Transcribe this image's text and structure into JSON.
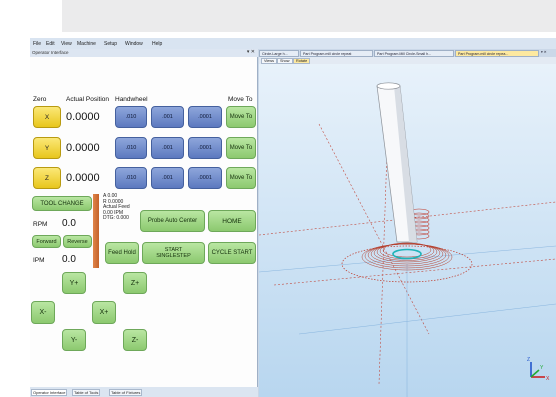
{
  "menu": [
    "File",
    "Edit",
    "View",
    "Machine",
    "Setup",
    "Window",
    "Help"
  ],
  "panel_title": "Operator Interface",
  "panel_pin": "▾ ✕",
  "headers": {
    "zero": "Zero",
    "actual_position": "Actual Position",
    "handwheel": "Handwheel",
    "move_to": "Move To"
  },
  "axes": [
    {
      "label": "X",
      "value": "0.0000",
      "steps": [
        ".010",
        ".001",
        ".0001"
      ],
      "move": "Move To"
    },
    {
      "label": "Y",
      "value": "0.0000",
      "steps": [
        ".010",
        ".001",
        ".0001"
      ],
      "move": "Move To"
    },
    {
      "label": "Z",
      "value": "0.0000",
      "steps": [
        ".010",
        ".001",
        ".0001"
      ],
      "move": "Move To"
    }
  ],
  "tool_change": "TOOL CHANGE",
  "rpm": {
    "label": "RPM",
    "value": "0.0"
  },
  "forward": "Forward",
  "reverse": "Reverse",
  "ipm": {
    "label": "IPM",
    "value": "0.0"
  },
  "status_lines": [
    "A 0.00",
    "R 0.0000",
    "Actual Feed",
    "0.00 IPM",
    "DTG: 0.000"
  ],
  "probe_auto_center": "Probe Auto Center",
  "home": "HOME",
  "feed_hold": "Feed Hold",
  "start_singlestep": [
    "START",
    "SINGLESTEP"
  ],
  "cycle_start": "CYCLE START",
  "jog": {
    "y_plus": "Y+",
    "z_plus": "Z+",
    "x_minus": "X-",
    "x_plus": "X+",
    "y_minus": "Y-",
    "z_minus": "Z-"
  },
  "bottom_tabs": [
    "Operator Interface",
    "Table of Tools",
    "Table of Fixtures"
  ],
  "doc_tabs": [
    "Circle-Large h...",
    "Part Program.mill circle repeat",
    "Part Program.Mill Circle-Small h...",
    "Part Program.mill circle repea..."
  ],
  "doc_controls": "▾ ✕",
  "view_tabs": [
    "Views",
    "Show",
    "Rotate"
  ],
  "colors": {
    "zero_buttons": "#f2d84a",
    "handwheel_buttons": "#7089cc",
    "action_buttons": "#a6d98c",
    "toolpath": "#c0392b",
    "viewport_bg": "#cfe3f4"
  },
  "axis_triad": {
    "x": "X",
    "y": "Y",
    "z": "Z"
  }
}
